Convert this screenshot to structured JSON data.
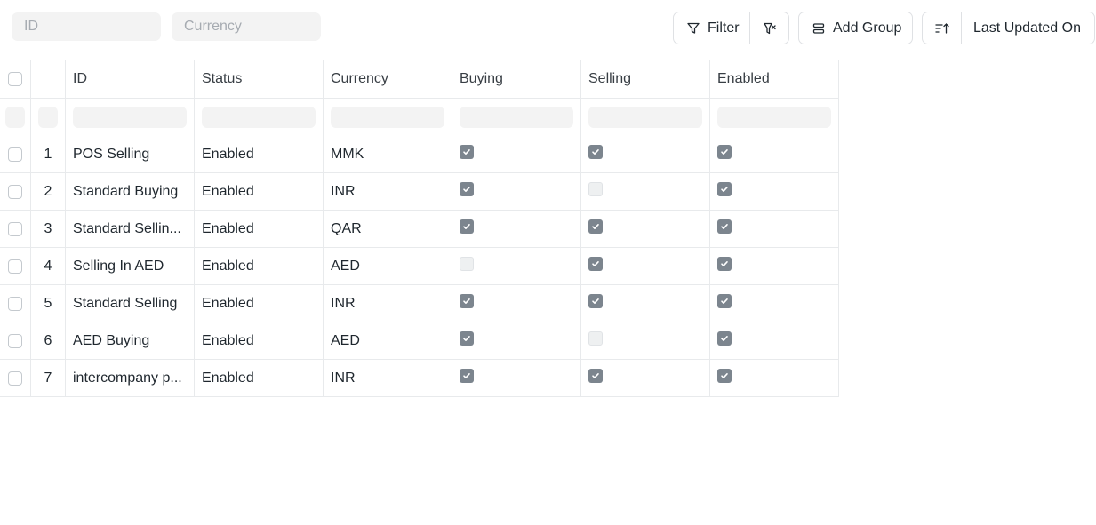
{
  "filters": {
    "id_placeholder": "ID",
    "currency_placeholder": "Currency"
  },
  "toolbar": {
    "filter_label": "Filter",
    "add_group_label": "Add Group",
    "sort_label": "Last Updated On"
  },
  "columns": [
    "ID",
    "Status",
    "Currency",
    "Buying",
    "Selling",
    "Enabled"
  ],
  "rows": [
    {
      "index": "1",
      "id": "POS Selling",
      "status": "Enabled",
      "currency": "MMK",
      "buying": true,
      "selling": true,
      "enabled": true
    },
    {
      "index": "2",
      "id": "Standard Buying",
      "status": "Enabled",
      "currency": "INR",
      "buying": true,
      "selling": false,
      "enabled": true
    },
    {
      "index": "3",
      "id": "Standard Sellin...",
      "status": "Enabled",
      "currency": "QAR",
      "buying": true,
      "selling": true,
      "enabled": true
    },
    {
      "index": "4",
      "id": "Selling In AED",
      "status": "Enabled",
      "currency": "AED",
      "buying": false,
      "selling": true,
      "enabled": true
    },
    {
      "index": "5",
      "id": "Standard Selling",
      "status": "Enabled",
      "currency": "INR",
      "buying": true,
      "selling": true,
      "enabled": true
    },
    {
      "index": "6",
      "id": "AED Buying",
      "status": "Enabled",
      "currency": "AED",
      "buying": true,
      "selling": false,
      "enabled": true
    },
    {
      "index": "7",
      "id": "intercompany p...",
      "status": "Enabled",
      "currency": "INR",
      "buying": true,
      "selling": true,
      "enabled": true
    }
  ],
  "icons": {
    "filter": "filter-icon",
    "clear_filter": "filter-x-icon",
    "group": "group-icon",
    "sort_direction": "sort-ascending-icon"
  },
  "colors": {
    "checked": "#7c858e",
    "border": "#e8eaec",
    "input_bg": "#f3f3f3"
  }
}
